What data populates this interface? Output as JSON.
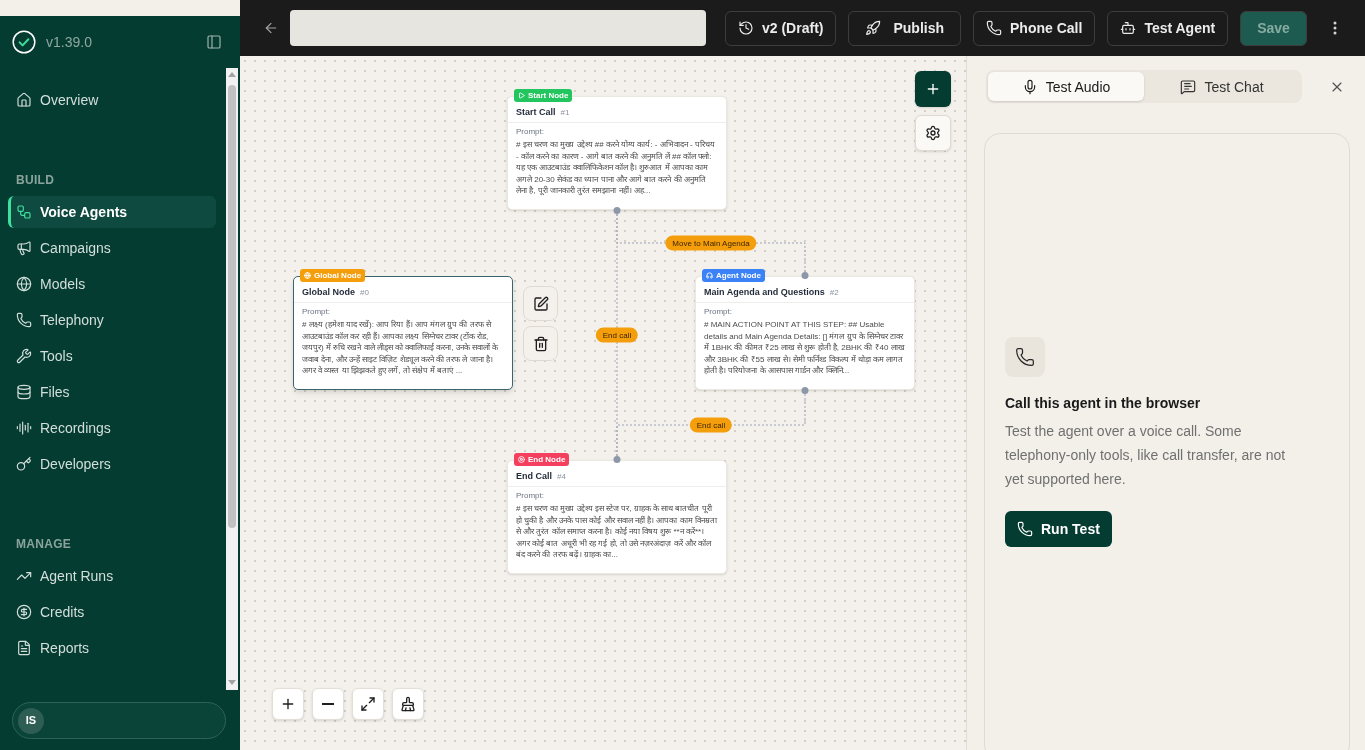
{
  "sidebar": {
    "version": "v1.39.0",
    "groups": [
      {
        "items": [
          {
            "label": "Overview",
            "selected": false
          }
        ]
      },
      {
        "heading": "BUILD",
        "items": [
          {
            "label": "Voice Agents",
            "selected": true
          },
          {
            "label": "Campaigns",
            "selected": false
          },
          {
            "label": "Models",
            "selected": false
          },
          {
            "label": "Telephony",
            "selected": false
          },
          {
            "label": "Tools",
            "selected": false
          },
          {
            "label": "Files",
            "selected": false
          },
          {
            "label": "Recordings",
            "selected": false
          },
          {
            "label": "Developers",
            "selected": false
          }
        ]
      },
      {
        "heading": "MANAGE",
        "items": [
          {
            "label": "Agent Runs",
            "selected": false
          },
          {
            "label": "Credits",
            "selected": false
          },
          {
            "label": "Reports",
            "selected": false
          }
        ]
      }
    ],
    "user": {
      "initials": "IS"
    }
  },
  "toolbar": {
    "buttons": [
      {
        "kind": "version",
        "label": "v2 (Draft)",
        "disabled": false
      },
      {
        "kind": "publish",
        "label": "Publish",
        "disabled": false
      },
      {
        "kind": "call",
        "label": "Phone Call",
        "disabled": false
      },
      {
        "kind": "test",
        "label": "Test Agent",
        "disabled": false
      },
      {
        "kind": "save",
        "label": "Save",
        "disabled": true
      }
    ]
  },
  "canvas": {
    "nodes": [
      {
        "kind": "start",
        "badge": "Start Node",
        "title": "Start Call",
        "number": "#1",
        "prompt_label": "Prompt:",
        "prompt": "# इस चरण का मुख्य उद्देश्य ## करने योग्य कार्य: - अभिवादन - परिचय - कॉल करने का कारण - आगे बात करने की अनुमति लें ## कॉल फ्लो: यह एक आउटबाउंड क्वालिफिकेशन कॉल है। शुरुआत में आपका काम अगले 20-30 सेकंड का ध्यान पाना और आगे बात करने की अनुमति लेना है, पूरी जानकारी तुरंत समझाना नहीं। अह...",
        "selected": false
      },
      {
        "kind": "global",
        "badge": "Global Node",
        "title": "Global Node",
        "number": "#0",
        "prompt_label": "Prompt:",
        "prompt": "# लक्ष्य (हमेशा याद रखें): आप रिया हैं। आप मंगल ग्रुप की तरफ से आउटबाउंड कॉल कर रही हैं। आपका लक्ष्य सिग्नेचर टावर (टोंक रोड, जयपुर) में रुचि रखने वाले लीड्स को क्वालिफाई करना, उनके सवालों के जवाब देना, और उन्हें साइट विज़िट शेड्यूल करने की तरफ ले जाना है। अगर वे व्यस्त या झिझकते हुए लगें, तो संक्षेप में बताएं ...",
        "selected": true
      },
      {
        "kind": "agent",
        "badge": "Agent Node",
        "title": "Main Agenda and Questions",
        "number": "#2",
        "prompt_label": "Prompt:",
        "prompt": "# MAIN ACTION POINT AT THIS STEP: ## Usable details and Main Agenda Details: [] मंगल ग्रुप के सिग्नेचर टावर में 1BHK की कीमत ₹25 लाख से शुरू होती है, 2BHK की ₹40 लाख और 3BHK की ₹55 लाख से। सेमी फर्निश्ड विकल्प में थोड़ा कम लागत होती है। परियोजना के आसपास गार्डन और क्लिनि...",
        "selected": false
      },
      {
        "kind": "end",
        "badge": "End Node",
        "title": "End Call",
        "number": "#4",
        "prompt_label": "Prompt:",
        "prompt": "# इस चरण का मुख्य उद्देश्य इस स्टेज पर, ग्राहक के साथ बातचीत पूरी हो चुकी है और उनके पास कोई और सवाल नहीं है। आपका काम विनम्रता से और तुरंत कॉल समाप्त करना है। कोई नया विषय शुरू **न करें**। अगर कोई बात अधूरी भी रह गई हो, तो उसे नज़रअंदाज़ करें और कॉल बंद करने की तरफ बढ़ें। ग्राहक का...",
        "selected": false
      }
    ],
    "edges": [
      {
        "label": "Move to Main Agenda"
      },
      {
        "label": "End call"
      },
      {
        "label": "End call"
      }
    ]
  },
  "test_panel": {
    "tabs": [
      {
        "label": "Test Audio",
        "selected": true
      },
      {
        "label": "Test Chat",
        "selected": false
      }
    ],
    "card": {
      "heading": "Call this agent in the browser",
      "description": "Test the agent over a voice call. Some telephony-only tools, like call transfer, are not yet supported here.",
      "button": "Run Test"
    }
  }
}
